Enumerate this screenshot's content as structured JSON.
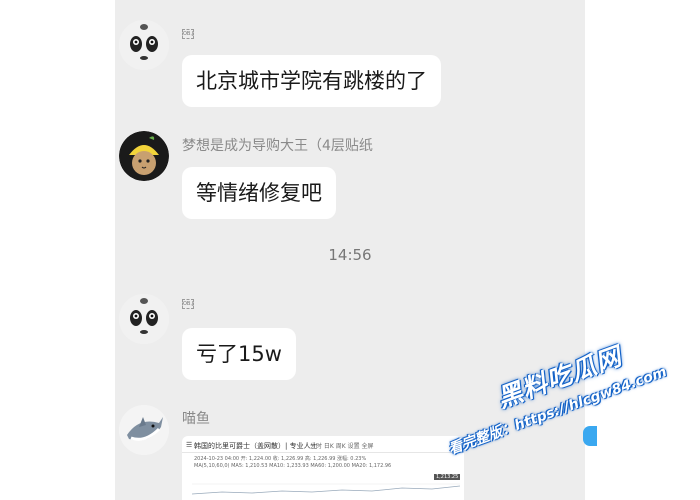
{
  "messages": [
    {
      "sender": "",
      "tag": "OB.J",
      "text": "北京城市学院有跳楼的了",
      "avatar": "panda-face-avatar"
    },
    {
      "sender": "梦想是成为导购大王（4层贴纸",
      "text": "等情绪修复吧",
      "avatar": "cat-lemon-hat-avatar"
    },
    {
      "sender": "",
      "tag": "OB.J",
      "text": "亏了15w",
      "avatar": "panda-face-avatar"
    },
    {
      "sender": "喵鱼",
      "avatar": "shark-avatar",
      "attachment": {
        "title": "韩国的比里可爵士（盖网散）| 专业人士",
        "tabs": "分时  日K  周K  设置  全屏",
        "row1": "2024-10-23 04:00   开: 1,224.00   收: 1,226.99   高: 1,226.99   涨幅: 0.23%",
        "row2": "MA(5,10,60,0)   MA5: 1,210.53   MA10: 1,233.93   MA60: 1,200.00   MA20: 1,172.96",
        "price_tag": "1,213.25"
      }
    }
  ],
  "timestamp": "14:56",
  "watermark": {
    "line1": "黑料吃瓜网",
    "line2": "看完整版：https://hlcgw84.com"
  },
  "colors": {
    "chat_bg": "#ededed",
    "bubble_bg": "#ffffff",
    "accent_blue": "#3aa8f0",
    "watermark_blue": "#1664c8"
  }
}
